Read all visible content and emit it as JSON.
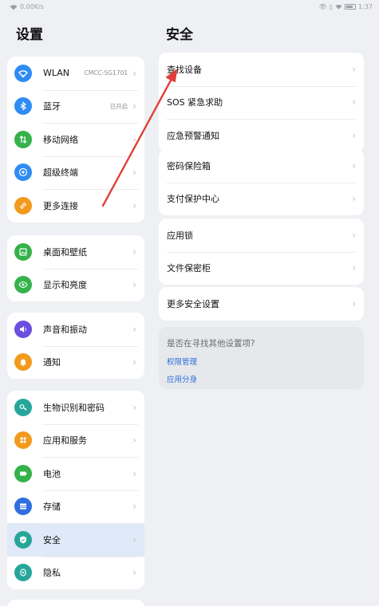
{
  "status_bar": {
    "speed": "0.00K/s",
    "time": "1:37"
  },
  "left_pane": {
    "title": "设置",
    "groups": [
      {
        "items": [
          {
            "label": "WLAN",
            "value": "CMCC-5G1701",
            "icon": "wifi-icon",
            "color": "#2f8cf4"
          },
          {
            "label": "蓝牙",
            "value": "已开启",
            "icon": "bluetooth-icon",
            "color": "#2f8cf4"
          },
          {
            "label": "移动网络",
            "value": "",
            "icon": "signal-icon",
            "color": "#35b24a"
          },
          {
            "label": "超级终端",
            "value": "",
            "icon": "super-device-icon",
            "color": "#2f8cf4"
          },
          {
            "label": "更多连接",
            "value": "",
            "icon": "link-icon",
            "color": "#f39a1c"
          }
        ]
      },
      {
        "items": [
          {
            "label": "桌面和壁纸",
            "value": "",
            "icon": "wallpaper-icon",
            "color": "#35b24a"
          },
          {
            "label": "显示和亮度",
            "value": "",
            "icon": "eye-icon",
            "color": "#35b24a"
          }
        ]
      },
      {
        "items": [
          {
            "label": "声音和振动",
            "value": "",
            "icon": "speaker-icon",
            "color": "#6b4fe0"
          },
          {
            "label": "通知",
            "value": "",
            "icon": "bell-icon",
            "color": "#f39a1c"
          }
        ]
      },
      {
        "items": [
          {
            "label": "生物识别和密码",
            "value": "",
            "icon": "key-icon",
            "color": "#26a69a"
          },
          {
            "label": "应用和服务",
            "value": "",
            "icon": "apps-icon",
            "color": "#f39a1c"
          },
          {
            "label": "电池",
            "value": "",
            "icon": "battery-icon",
            "color": "#35b24a"
          },
          {
            "label": "存储",
            "value": "",
            "icon": "storage-icon",
            "color": "#2f6fe0"
          },
          {
            "label": "安全",
            "value": "",
            "icon": "shield-icon",
            "color": "#26a69a"
          },
          {
            "label": "隐私",
            "value": "",
            "icon": "privacy-icon",
            "color": "#26a69a"
          }
        ]
      }
    ]
  },
  "right_pane": {
    "title": "安全",
    "groups": [
      {
        "items": [
          {
            "label": "查找设备"
          },
          {
            "label": "SOS 紧急求助"
          },
          {
            "label": "应急预警通知"
          }
        ]
      },
      {
        "items": [
          {
            "label": "密码保险箱"
          },
          {
            "label": "支付保护中心"
          }
        ]
      },
      {
        "items": [
          {
            "label": "应用锁"
          },
          {
            "label": "文件保密柜"
          }
        ]
      },
      {
        "items": [
          {
            "label": "更多安全设置"
          }
        ]
      }
    ],
    "hint": {
      "question": "是否在寻找其他设置项?",
      "links": [
        "权限管理",
        "应用分身"
      ]
    }
  },
  "colors": {
    "accent": "#2f8cf4",
    "selected_bg": "#dfe9f7",
    "arrow": "#e0403a"
  }
}
